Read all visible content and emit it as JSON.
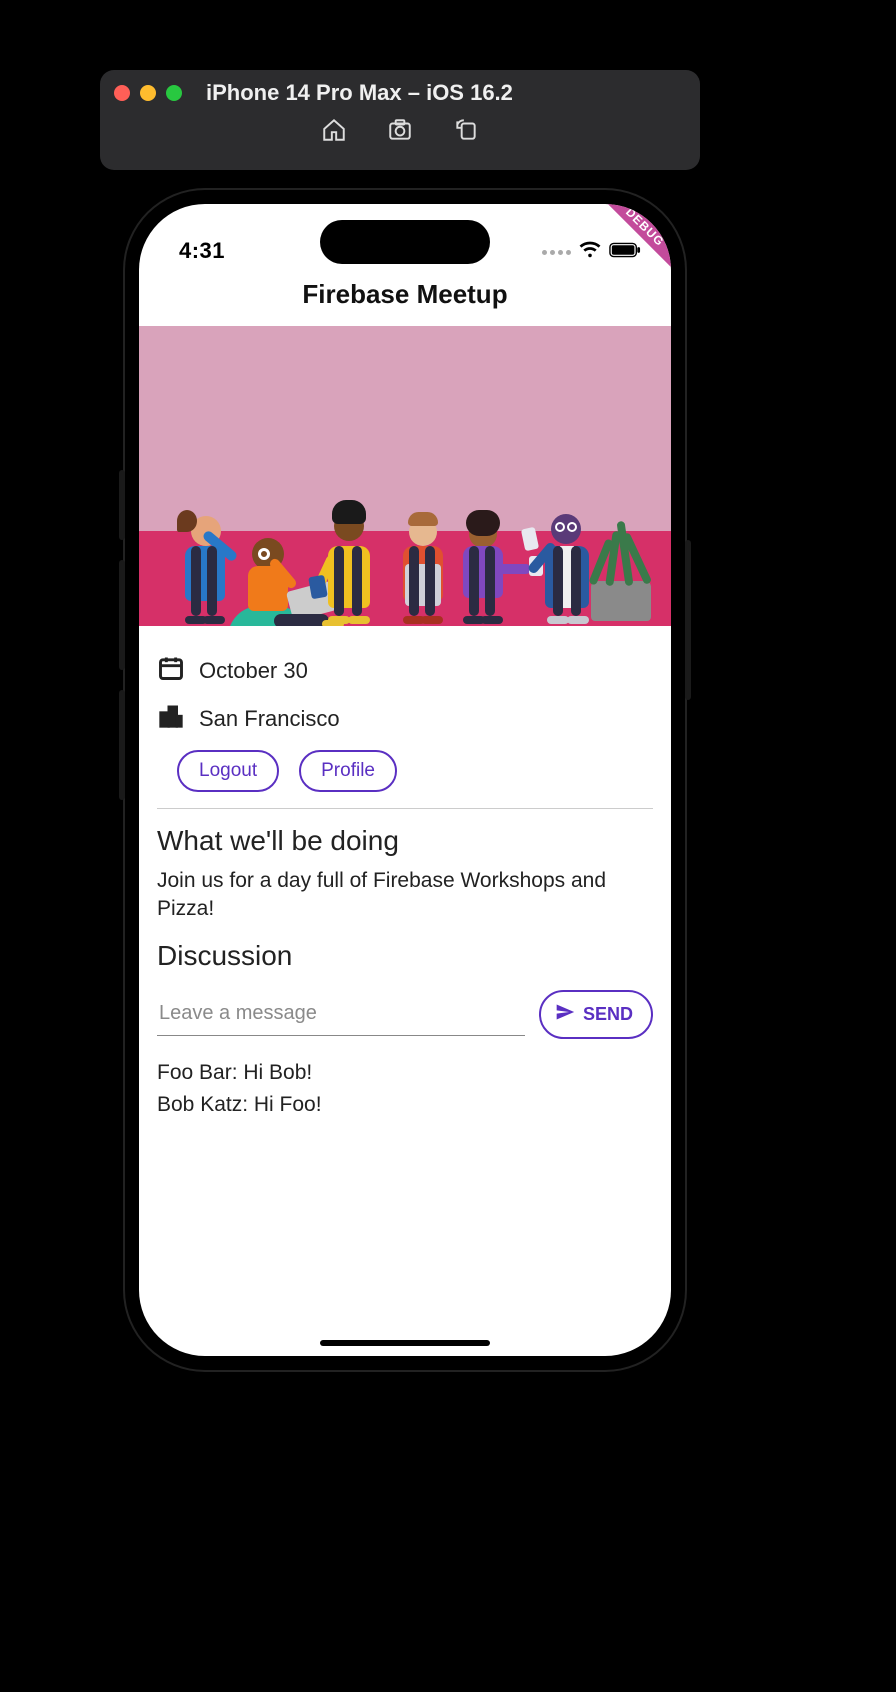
{
  "simulator": {
    "title": "iPhone 14 Pro Max – iOS 16.2"
  },
  "status": {
    "time": "4:31"
  },
  "debug_banner": "DEBUG",
  "appbar": {
    "title": "Firebase Meetup"
  },
  "event": {
    "date": "October 30",
    "location": "San Francisco"
  },
  "actions": {
    "logout_label": "Logout",
    "profile_label": "Profile"
  },
  "section_about": {
    "heading": "What we'll be doing",
    "body": "Join us for a day full of Firebase Workshops and Pizza!"
  },
  "section_discussion": {
    "heading": "Discussion",
    "input_placeholder": "Leave a message",
    "send_label": "SEND",
    "messages": [
      "Foo Bar: Hi Bob!",
      "Bob Katz: Hi Foo!"
    ]
  },
  "colors": {
    "accent": "#5a2fc2",
    "hero_bg": "#d9a3bb",
    "hero_floor": "#d63068"
  }
}
